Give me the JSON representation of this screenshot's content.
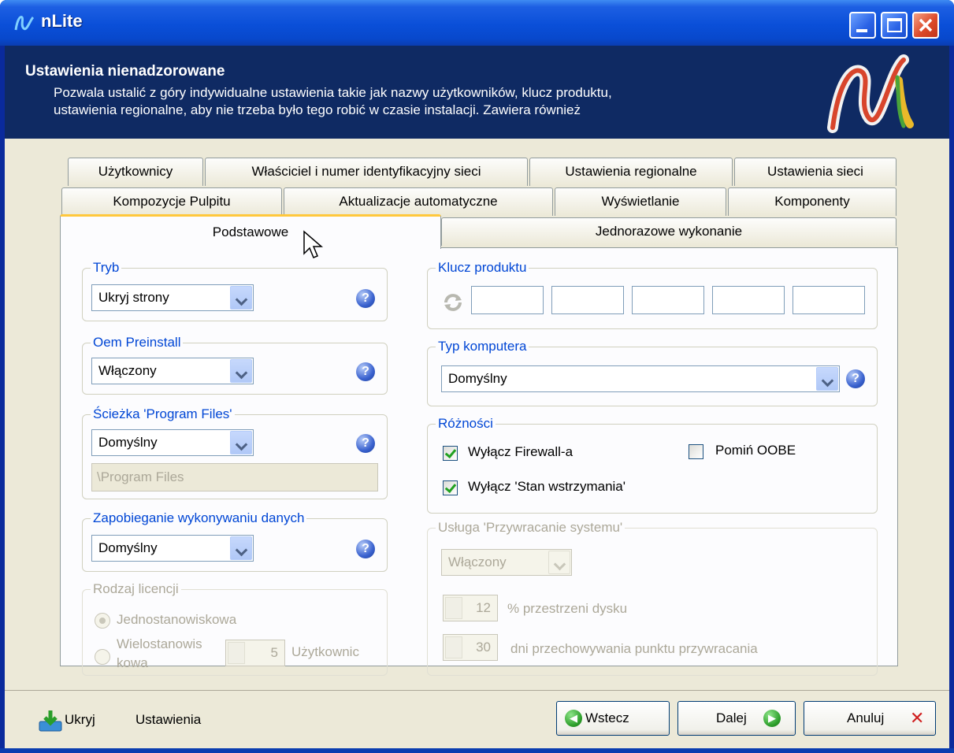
{
  "window": {
    "title": "nLite"
  },
  "header": {
    "title": "Ustawienia nienadzorowane",
    "description_line1": "Pozwala ustalić z góry indywidualne ustawienia takie jak nazwy użytkowników, klucz produktu,",
    "description_line2": "ustawienia regionalne, aby nie trzeba było tego robić w czasie instalacji. Zawiera również"
  },
  "tabs": {
    "row1": [
      "Użytkownicy",
      "Właściciel i numer identyfikacyjny sieci",
      "Ustawienia regionalne",
      "Ustawienia sieci"
    ],
    "row2": [
      "Kompozycje Pulpitu",
      "Aktualizacje automatyczne",
      "Wyświetlanie",
      "Komponenty"
    ],
    "row3": [
      "Podstawowe",
      "Jednorazowe wykonanie"
    ],
    "active": "Podstawowe"
  },
  "left": {
    "tryb": {
      "legend": "Tryb",
      "value": "Ukryj strony"
    },
    "oem": {
      "legend": "Oem Preinstall",
      "value": "Włączony"
    },
    "program_files": {
      "legend": "Ścieżka 'Program Files'",
      "value": "Domyślny",
      "path": "\\Program Files"
    },
    "dep": {
      "legend": "Zapobieganie wykonywaniu danych",
      "value": "Domyślny"
    },
    "license": {
      "legend": "Rodzaj licencji",
      "option1": "Jednostanowiskowa",
      "option2": "Wielostanowis",
      "option2_cont": "kowa",
      "users_value": "5",
      "users_label": "Użytkownic"
    }
  },
  "right": {
    "product_key": {
      "legend": "Klucz produktu"
    },
    "computer_type": {
      "legend": "Typ komputera",
      "value": "Domyślny"
    },
    "misc": {
      "legend": "Różności",
      "firewall": "Wyłącz Firewall-a",
      "firewall_checked": true,
      "hibernate": "Wyłącz 'Stan wstrzymania'",
      "hibernate_checked": true,
      "skip_oobe": "Pomiń OOBE",
      "skip_oobe_checked": false
    },
    "restore": {
      "legend": "Usługa 'Przywracanie systemu'",
      "value": "Włączony",
      "disk_value": "12",
      "disk_label": "% przestrzeni dysku",
      "days_value": "30",
      "days_label": "dni przechowywania punktu przywracania"
    }
  },
  "footer": {
    "hide_label": "Ukryj",
    "settings_label": "Ustawienia",
    "back_label": "Wstecz",
    "next_label": "Dalej",
    "cancel_label": "Anuluj"
  },
  "icons": {
    "help": "?",
    "next_arrow": "▶",
    "back_arrow": "◀",
    "cancel_x": "✕"
  },
  "colors": {
    "titlebar": "#0a4fd8",
    "header": "#0f2a63",
    "legend": "#0046d5",
    "accent": "#ffc83c"
  }
}
